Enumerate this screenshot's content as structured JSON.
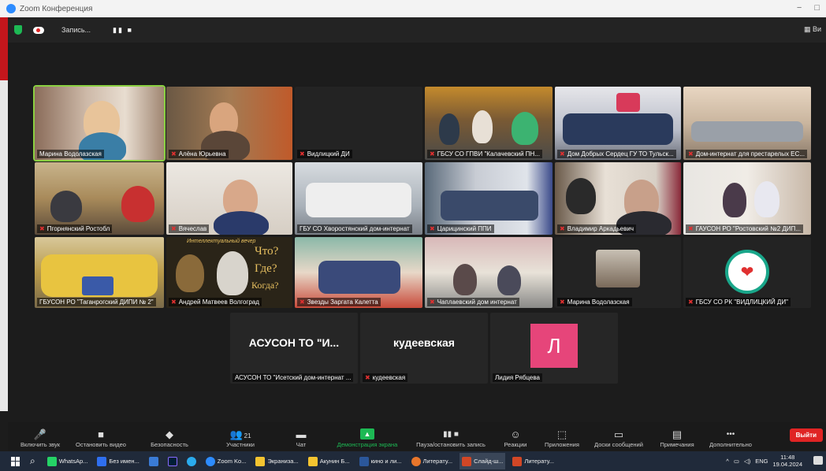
{
  "window": {
    "title": "Zoom Конференция",
    "controls": [
      "−",
      "□"
    ]
  },
  "topbar": {
    "record_label": "Запись...",
    "record_controls": "▮▮ ■",
    "view_label": "▦ Ви"
  },
  "tiles": [
    {
      "name": "Марина Водолазская",
      "muted": false,
      "active": true
    },
    {
      "name": "Алёна Юрьевна",
      "muted": true
    },
    {
      "name": "Видлицкий ДИ",
      "muted": true
    },
    {
      "name": "ГБСУ СО ГПВИ \"Калачевский ПН...",
      "muted": true
    },
    {
      "name": "Дом Добрых Сердец ГУ ТО Тульск...",
      "muted": true
    },
    {
      "name": "Дом-интернат для престарелых ЕС...",
      "muted": true
    },
    {
      "name": "Пгорнянский Ростобл",
      "muted": true
    },
    {
      "name": "Вячеслав",
      "muted": true
    },
    {
      "name": "ГБУ СО Хворостянский дом-интернат",
      "muted": false
    },
    {
      "name": "Царицинский ППИ",
      "muted": true
    },
    {
      "name": "Владимир Аркадьевич",
      "muted": true
    },
    {
      "name": "ГАУСОН РО \"Ростовский №2 ДИП...",
      "muted": true
    },
    {
      "name": "ГБУСОН РО \"Таганрогский ДИПИ № 2\"",
      "muted": false
    },
    {
      "name": "Андрей Матвеев Волгоград",
      "muted": true
    },
    {
      "name": "Звезды Заргата Калетта",
      "muted": true
    },
    {
      "name": "Чаплаевский дом интернат",
      "muted": true
    },
    {
      "name": "Марина Водолазская",
      "muted": true
    },
    {
      "name": "ГБСУ СО РК \"ВИДЛИЦКИЙ ДИ\"",
      "muted": true
    },
    {
      "name": "АСУСОН ТО \"Исетский дом-интернат ...",
      "muted": false,
      "display": "АСУСОН ТО \"И..."
    },
    {
      "name": "кудеевская",
      "muted": true,
      "display": "кудеевская"
    },
    {
      "name": "Лидия Рябцева",
      "muted": false,
      "initial": "Л"
    }
  ],
  "slide_text": {
    "header": "Интеллектуальный вечер",
    "q1": "Что?",
    "q2": "Где?",
    "q3": "Когда?"
  },
  "toolbar": {
    "items": [
      {
        "label": "Включить звук",
        "icon": "🎤"
      },
      {
        "label": "Остановить видео",
        "icon": "■"
      },
      {
        "label": "Безопасность",
        "icon": "◆"
      },
      {
        "label": "Участники",
        "icon": "👥",
        "count": "21"
      },
      {
        "label": "Чат",
        "icon": "▬"
      },
      {
        "label": "Демонстрация экрана",
        "icon": "▲",
        "green": true
      },
      {
        "label": "Пауза/остановить запись",
        "icon": "▮▮ ■"
      },
      {
        "label": "Реакции",
        "icon": "☺"
      },
      {
        "label": "Приложения",
        "icon": "⬚"
      },
      {
        "label": "Доски сообщений",
        "icon": "▭"
      },
      {
        "label": "Примечания",
        "icon": "▤"
      },
      {
        "label": "Дополнительно",
        "icon": "•••"
      }
    ],
    "exit_label": "Выйти"
  },
  "taskbar": {
    "items": [
      {
        "label": "WhatsAp...",
        "color": "#25d366"
      },
      {
        "label": "Без имен...",
        "color": "#2f6ff0"
      },
      {
        "label": "",
        "color": "#3a7bd5"
      },
      {
        "label": "",
        "color": "#001e36"
      },
      {
        "label": "",
        "color": "#2aabee"
      },
      {
        "label": "Zoom Ko...",
        "color": "#2d8cff"
      },
      {
        "label": "Экранизa...",
        "color": "#f4c430"
      },
      {
        "label": "Акунин Б...",
        "color": "#f4c430"
      },
      {
        "label": "кино и ли...",
        "color": "#2b579a"
      },
      {
        "label": "Литерату...",
        "color": "#e8762b"
      },
      {
        "label": "Слайд-ш...",
        "color": "#d24726",
        "active": true
      },
      {
        "label": "Литерату...",
        "color": "#d24726"
      }
    ],
    "lang": "ENG",
    "time": "11:48",
    "date": "19.04.2024"
  }
}
